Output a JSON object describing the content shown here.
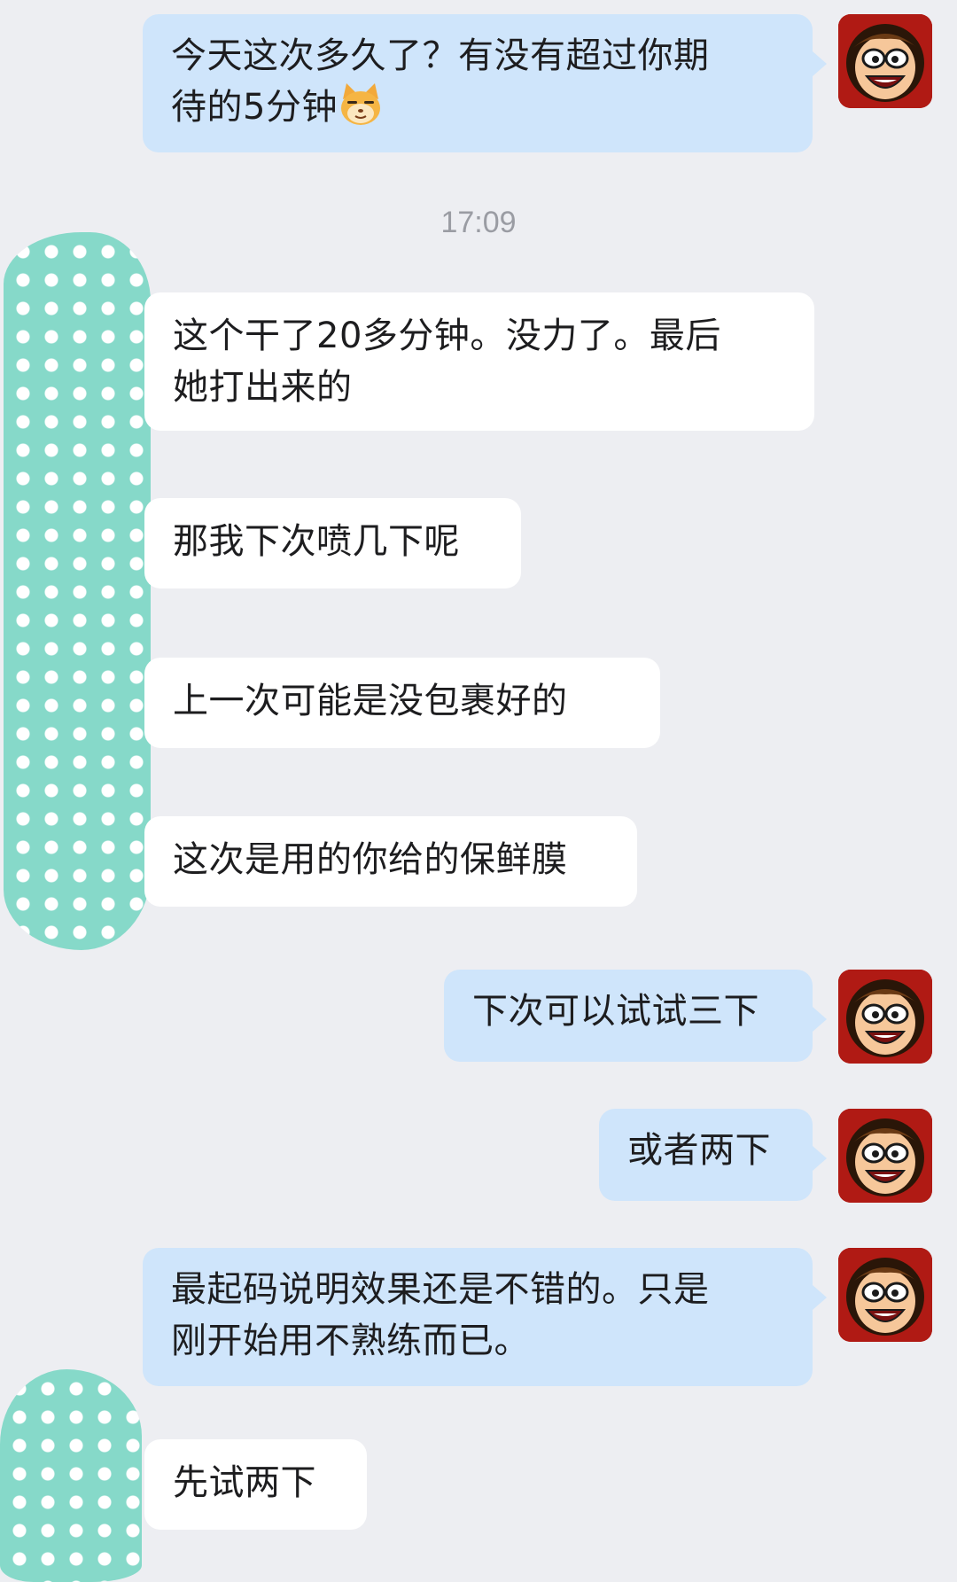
{
  "timestamp": "17:09",
  "messages": [
    {
      "side": "out",
      "lines": [
        "今天这次多久了？有没有超过你期",
        "待的5分钟"
      ],
      "has_emoji": true,
      "emoji_name": "cat-face-emoji"
    },
    {
      "side": "in",
      "text_lines": [
        "这个干了20多分钟。没力了。最后",
        "她打出来的"
      ]
    },
    {
      "side": "in",
      "text": "那我下次喷几下呢"
    },
    {
      "side": "in",
      "text": "上一次可能是没包裹好的"
    },
    {
      "side": "in",
      "text": "这次是用的你给的保鲜膜"
    },
    {
      "side": "out",
      "text": "下次可以试试三下"
    },
    {
      "side": "out",
      "text": "或者两下"
    },
    {
      "side": "out",
      "lines": [
        "最起码说明效果还是不错的。只是",
        "刚开始用不熟练而已。"
      ]
    },
    {
      "side": "in",
      "text": "先试两下"
    }
  ],
  "colors": {
    "background": "#edeef2",
    "outgoing_bubble": "#cfe5fb",
    "incoming_bubble": "#ffffff",
    "avatar_ring": "#b01a14",
    "sticker_mint": "#86d9c9"
  },
  "icons": {
    "avatar": "cartoon-boy-avatar-icon",
    "sticker": "polka-dot-sticker"
  }
}
